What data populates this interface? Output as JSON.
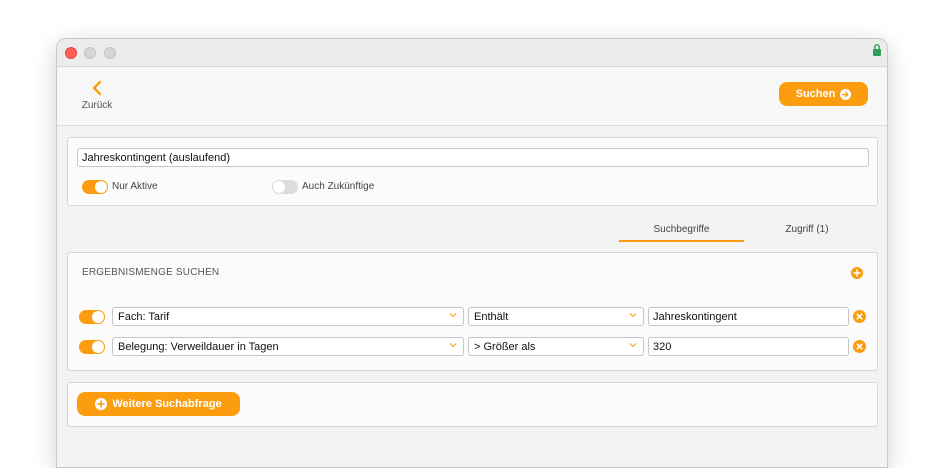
{
  "header": {
    "back_label": "Zurück",
    "search_label": "Suchen"
  },
  "filter": {
    "query_value": "Jahreskontingent (auslaufend)",
    "only_active_label": "Nur Aktive",
    "only_active_on": true,
    "include_future_label": "Auch Zukünftige",
    "include_future_on": false
  },
  "tabs": [
    {
      "label": "Suchbegriffe",
      "active": true
    },
    {
      "label": "Zugriff (1)",
      "active": false
    }
  ],
  "criteria": {
    "title": "ERGEBNISMENGE SUCHEN",
    "rows": [
      {
        "enabled": true,
        "field": "Fach: Tarif",
        "operator": "Enthält",
        "value": "Jahreskontingent"
      },
      {
        "enabled": true,
        "field": "Belegung: Verweildauer in Tagen",
        "operator": "> Größer als",
        "value": "320"
      }
    ]
  },
  "footer": {
    "more_query_label": "Weitere Suchabfrage"
  },
  "colors": {
    "accent": "#fb9d0e",
    "close_light": "#fe5f57",
    "lock": "#2e9e58"
  }
}
